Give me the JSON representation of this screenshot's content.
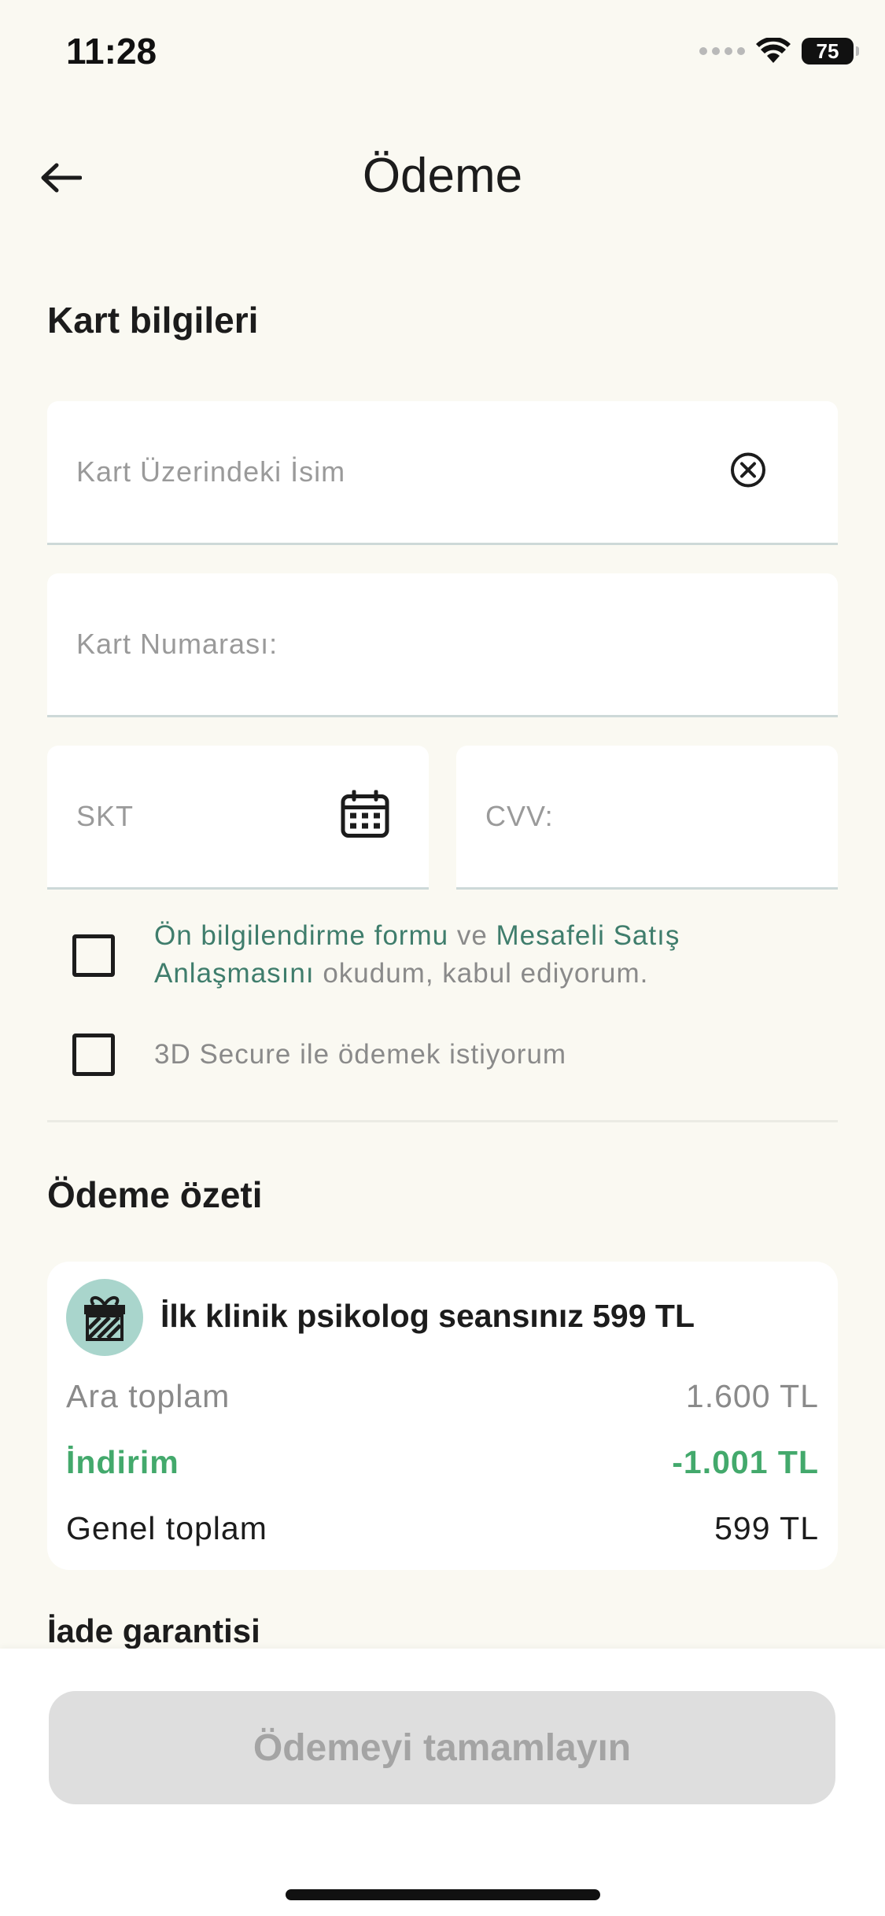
{
  "status_bar": {
    "time": "11:28",
    "battery": "75"
  },
  "header": {
    "title": "Ödeme"
  },
  "card_section": {
    "title": "Kart bilgileri",
    "name_placeholder": "Kart Üzerindeki İsim",
    "number_placeholder": "Kart Numarası:",
    "expiry_placeholder": "SKT",
    "cvv_placeholder": "CVV:"
  },
  "agreements": {
    "link_preinfo": "Ön bilgilendirme formu",
    "conj": " ve ",
    "link_distance_sales": "Mesafeli Satış Anlaşmasını",
    "suffix": " okudum, kabul ediyorum.",
    "secure_label": "3D Secure ile ödemek istiyorum"
  },
  "summary": {
    "title": "Ödeme özeti",
    "promo_title": "İlk klinik psikolog seansınız 599 TL",
    "rows": [
      {
        "label": "Ara toplam",
        "value": "1.600 TL"
      },
      {
        "label": "İndirim",
        "value": "-1.001 TL"
      },
      {
        "label": "Genel toplam",
        "value": "599 TL"
      }
    ]
  },
  "refund": {
    "title": "İade garantisi"
  },
  "footer": {
    "pay_button": "Ödemeyi tamamlayın"
  },
  "colors": {
    "background": "#faf9f2",
    "accent_link": "#3f7d6c",
    "discount": "#43a96c",
    "gift_badge": "#a9d5cc",
    "button_disabled": "#dedede"
  }
}
